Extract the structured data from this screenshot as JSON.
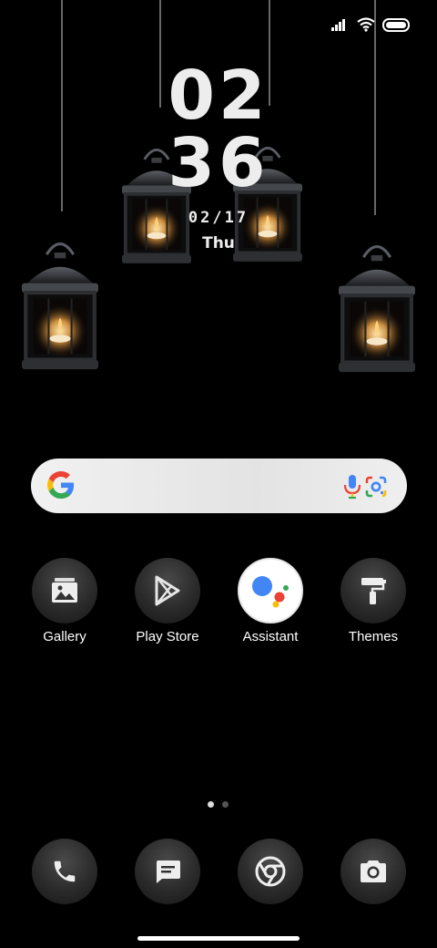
{
  "clock": {
    "hour": "02",
    "minute": "36",
    "date": "02/17",
    "day": "Thu"
  },
  "apps": [
    {
      "label": "Gallery",
      "icon": "gallery-icon"
    },
    {
      "label": "Play Store",
      "icon": "play-store-icon"
    },
    {
      "label": "Assistant",
      "icon": "assistant-icon"
    },
    {
      "label": "Themes",
      "icon": "themes-icon"
    }
  ],
  "dock": [
    {
      "icon": "phone-icon"
    },
    {
      "icon": "messages-icon"
    },
    {
      "icon": "chrome-icon"
    },
    {
      "icon": "camera-icon"
    }
  ],
  "pager": {
    "pages": 2,
    "active": 1
  },
  "colors": {
    "background": "#000000",
    "search_bar": "#ececec",
    "google_blue": "#4285F4",
    "google_red": "#EA4335",
    "google_yellow": "#FBBC05",
    "google_green": "#34A853"
  }
}
